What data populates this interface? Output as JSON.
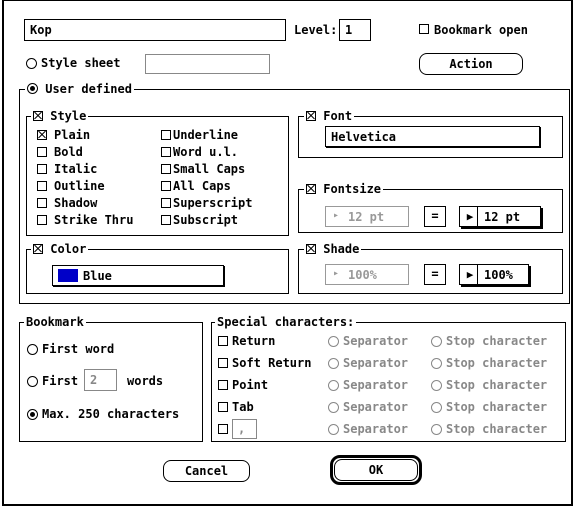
{
  "top": {
    "name_value": "Kop",
    "level_label": "Level:",
    "level_value": "1",
    "bookmark_open_label": "Bookmark open",
    "style_sheet_label": "Style sheet",
    "style_sheet_value": "",
    "action_label": "Action",
    "user_defined_label": "User defined"
  },
  "style": {
    "title": "Style",
    "items_left": [
      {
        "label": "Plain",
        "checked": true
      },
      {
        "label": "Bold",
        "checked": false
      },
      {
        "label": "Italic",
        "checked": false
      },
      {
        "label": "Outline",
        "checked": false
      },
      {
        "label": "Shadow",
        "checked": false
      },
      {
        "label": "Strike Thru",
        "checked": false
      }
    ],
    "items_right": [
      {
        "label": "Underline",
        "checked": false
      },
      {
        "label": "Word u.l.",
        "checked": false
      },
      {
        "label": "Small Caps",
        "checked": false
      },
      {
        "label": "All Caps",
        "checked": false
      },
      {
        "label": "Superscript",
        "checked": false
      },
      {
        "label": "Subscript",
        "checked": false
      }
    ]
  },
  "font": {
    "title": "Font",
    "value": "Helvetica"
  },
  "fontsize": {
    "title": "Fontsize",
    "current": "12 pt",
    "equals": "=",
    "value": "12 pt"
  },
  "color": {
    "title": "Color",
    "value": "Blue",
    "swatch": "#0000c8"
  },
  "shade": {
    "title": "Shade",
    "current": "100%",
    "equals": "=",
    "value": "100%"
  },
  "bookmark": {
    "title": "Bookmark",
    "first_word": "First word",
    "first_label": "First",
    "first_count": "2",
    "words_label": "words",
    "max_label": "Max. 250 characters"
  },
  "special": {
    "title": "Special characters:",
    "rows": [
      {
        "label": "Return",
        "separator": "Separator",
        "stop": "Stop character"
      },
      {
        "label": "Soft Return",
        "separator": "Separator",
        "stop": "Stop character"
      },
      {
        "label": "Point",
        "separator": "Separator",
        "stop": "Stop character"
      },
      {
        "label": "Tab",
        "separator": "Separator",
        "stop": "Stop character"
      },
      {
        "label": "",
        "custom_value": ",",
        "separator": "Separator",
        "stop": "Stop character"
      }
    ]
  },
  "buttons": {
    "cancel": "Cancel",
    "ok": "OK"
  }
}
